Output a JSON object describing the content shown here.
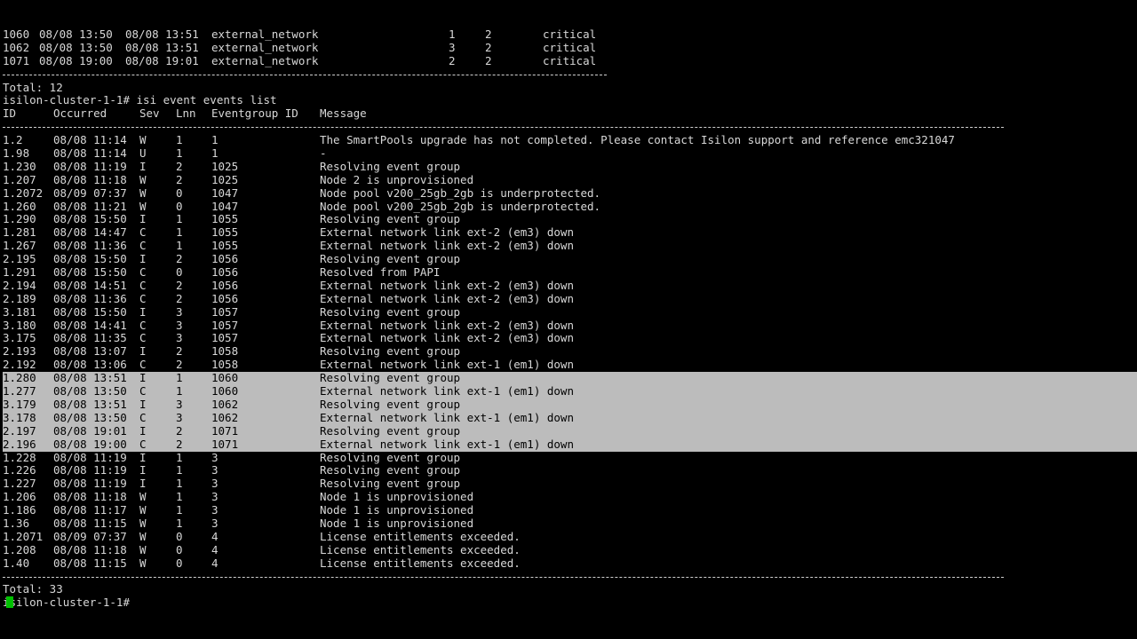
{
  "prev_events": [
    {
      "id": "1060",
      "start": "08/08 13:50",
      "end": "08/08 13:51",
      "type": "external_network",
      "c1": "1",
      "c2": "2",
      "severity": "critical"
    },
    {
      "id": "1062",
      "start": "08/08 13:50",
      "end": "08/08 13:51",
      "type": "external_network",
      "c1": "3",
      "c2": "2",
      "severity": "critical"
    },
    {
      "id": "1071",
      "start": "08/08 19:00",
      "end": "08/08 19:01",
      "type": "external_network",
      "c1": "2",
      "c2": "2",
      "severity": "critical"
    }
  ],
  "prev_total": "Total: 12",
  "command_line": "isilon-cluster-1-1# isi event events list",
  "headers": {
    "id": "ID",
    "occurred": "Occurred",
    "sev": "Sev",
    "lnn": "Lnn",
    "eventgroup": "Eventgroup ID",
    "message": "Message"
  },
  "rows": [
    {
      "id": "1.2",
      "occurred": "08/08 11:14",
      "sev": "W",
      "lnn": "1",
      "eg": "1",
      "msg": "The SmartPools upgrade has not completed. Please contact Isilon support and reference emc321047",
      "selected": false
    },
    {
      "id": "1.98",
      "occurred": "08/08 11:14",
      "sev": "U",
      "lnn": "1",
      "eg": "1",
      "msg": "-",
      "selected": false
    },
    {
      "id": "1.230",
      "occurred": "08/08 11:19",
      "sev": "I",
      "lnn": "2",
      "eg": "1025",
      "msg": "Resolving event group",
      "selected": false
    },
    {
      "id": "1.207",
      "occurred": "08/08 11:18",
      "sev": "W",
      "lnn": "2",
      "eg": "1025",
      "msg": "Node 2 is unprovisioned",
      "selected": false
    },
    {
      "id": "1.2072",
      "occurred": "08/09 07:37",
      "sev": "W",
      "lnn": "0",
      "eg": "1047",
      "msg": "Node pool v200_25gb_2gb is underprotected.",
      "selected": false
    },
    {
      "id": "1.260",
      "occurred": "08/08 11:21",
      "sev": "W",
      "lnn": "0",
      "eg": "1047",
      "msg": "Node pool v200_25gb_2gb is underprotected.",
      "selected": false
    },
    {
      "id": "1.290",
      "occurred": "08/08 15:50",
      "sev": "I",
      "lnn": "1",
      "eg": "1055",
      "msg": "Resolving event group",
      "selected": false
    },
    {
      "id": "1.281",
      "occurred": "08/08 14:47",
      "sev": "C",
      "lnn": "1",
      "eg": "1055",
      "msg": "External network link ext-2 (em3) down",
      "selected": false
    },
    {
      "id": "1.267",
      "occurred": "08/08 11:36",
      "sev": "C",
      "lnn": "1",
      "eg": "1055",
      "msg": "External network link ext-2 (em3) down",
      "selected": false
    },
    {
      "id": "2.195",
      "occurred": "08/08 15:50",
      "sev": "I",
      "lnn": "2",
      "eg": "1056",
      "msg": "Resolving event group",
      "selected": false
    },
    {
      "id": "1.291",
      "occurred": "08/08 15:50",
      "sev": "C",
      "lnn": "0",
      "eg": "1056",
      "msg": "Resolved from PAPI",
      "selected": false
    },
    {
      "id": "2.194",
      "occurred": "08/08 14:51",
      "sev": "C",
      "lnn": "2",
      "eg": "1056",
      "msg": "External network link ext-2 (em3) down",
      "selected": false
    },
    {
      "id": "2.189",
      "occurred": "08/08 11:36",
      "sev": "C",
      "lnn": "2",
      "eg": "1056",
      "msg": "External network link ext-2 (em3) down",
      "selected": false
    },
    {
      "id": "3.181",
      "occurred": "08/08 15:50",
      "sev": "I",
      "lnn": "3",
      "eg": "1057",
      "msg": "Resolving event group",
      "selected": false
    },
    {
      "id": "3.180",
      "occurred": "08/08 14:41",
      "sev": "C",
      "lnn": "3",
      "eg": "1057",
      "msg": "External network link ext-2 (em3) down",
      "selected": false
    },
    {
      "id": "3.175",
      "occurred": "08/08 11:35",
      "sev": "C",
      "lnn": "3",
      "eg": "1057",
      "msg": "External network link ext-2 (em3) down",
      "selected": false
    },
    {
      "id": "2.193",
      "occurred": "08/08 13:07",
      "sev": "I",
      "lnn": "2",
      "eg": "1058",
      "msg": "Resolving event group",
      "selected": false
    },
    {
      "id": "2.192",
      "occurred": "08/08 13:06",
      "sev": "C",
      "lnn": "2",
      "eg": "1058",
      "msg": "External network link ext-1 (em1) down",
      "selected": false
    },
    {
      "id": "1.280",
      "occurred": "08/08 13:51",
      "sev": "I",
      "lnn": "1",
      "eg": "1060",
      "msg": "Resolving event group",
      "selected": true
    },
    {
      "id": "1.277",
      "occurred": "08/08 13:50",
      "sev": "C",
      "lnn": "1",
      "eg": "1060",
      "msg": "External network link ext-1 (em1) down",
      "selected": true
    },
    {
      "id": "3.179",
      "occurred": "08/08 13:51",
      "sev": "I",
      "lnn": "3",
      "eg": "1062",
      "msg": "Resolving event group",
      "selected": true
    },
    {
      "id": "3.178",
      "occurred": "08/08 13:50",
      "sev": "C",
      "lnn": "3",
      "eg": "1062",
      "msg": "External network link ext-1 (em1) down",
      "selected": true
    },
    {
      "id": "2.197",
      "occurred": "08/08 19:01",
      "sev": "I",
      "lnn": "2",
      "eg": "1071",
      "msg": "Resolving event group",
      "selected": true
    },
    {
      "id": "2.196",
      "occurred": "08/08 19:00",
      "sev": "C",
      "lnn": "2",
      "eg": "1071",
      "msg": "External network link ext-1 (em1) down",
      "selected": true
    },
    {
      "id": "1.228",
      "occurred": "08/08 11:19",
      "sev": "I",
      "lnn": "1",
      "eg": "3",
      "msg": "Resolving event group",
      "selected": false
    },
    {
      "id": "1.226",
      "occurred": "08/08 11:19",
      "sev": "I",
      "lnn": "1",
      "eg": "3",
      "msg": "Resolving event group",
      "selected": false
    },
    {
      "id": "1.227",
      "occurred": "08/08 11:19",
      "sev": "I",
      "lnn": "1",
      "eg": "3",
      "msg": "Resolving event group",
      "selected": false
    },
    {
      "id": "1.206",
      "occurred": "08/08 11:18",
      "sev": "W",
      "lnn": "1",
      "eg": "3",
      "msg": "Node 1 is unprovisioned",
      "selected": false
    },
    {
      "id": "1.186",
      "occurred": "08/08 11:17",
      "sev": "W",
      "lnn": "1",
      "eg": "3",
      "msg": "Node 1 is unprovisioned",
      "selected": false
    },
    {
      "id": "1.36",
      "occurred": "08/08 11:15",
      "sev": "W",
      "lnn": "1",
      "eg": "3",
      "msg": "Node 1 is unprovisioned",
      "selected": false
    },
    {
      "id": "1.2071",
      "occurred": "08/09 07:37",
      "sev": "W",
      "lnn": "0",
      "eg": "4",
      "msg": "License entitlements exceeded.",
      "selected": false
    },
    {
      "id": "1.208",
      "occurred": "08/08 11:18",
      "sev": "W",
      "lnn": "0",
      "eg": "4",
      "msg": "License entitlements exceeded.",
      "selected": false
    },
    {
      "id": "1.40",
      "occurred": "08/08 11:15",
      "sev": "W",
      "lnn": "0",
      "eg": "4",
      "msg": "License entitlements exceeded.",
      "selected": false
    }
  ],
  "total": "Total: 33",
  "prompt": "isilon-cluster-1-1#",
  "colors": {
    "background": "#000000",
    "text": "#d8d8d8",
    "selection": "#bcbcbc",
    "cursor": "#00c000"
  }
}
